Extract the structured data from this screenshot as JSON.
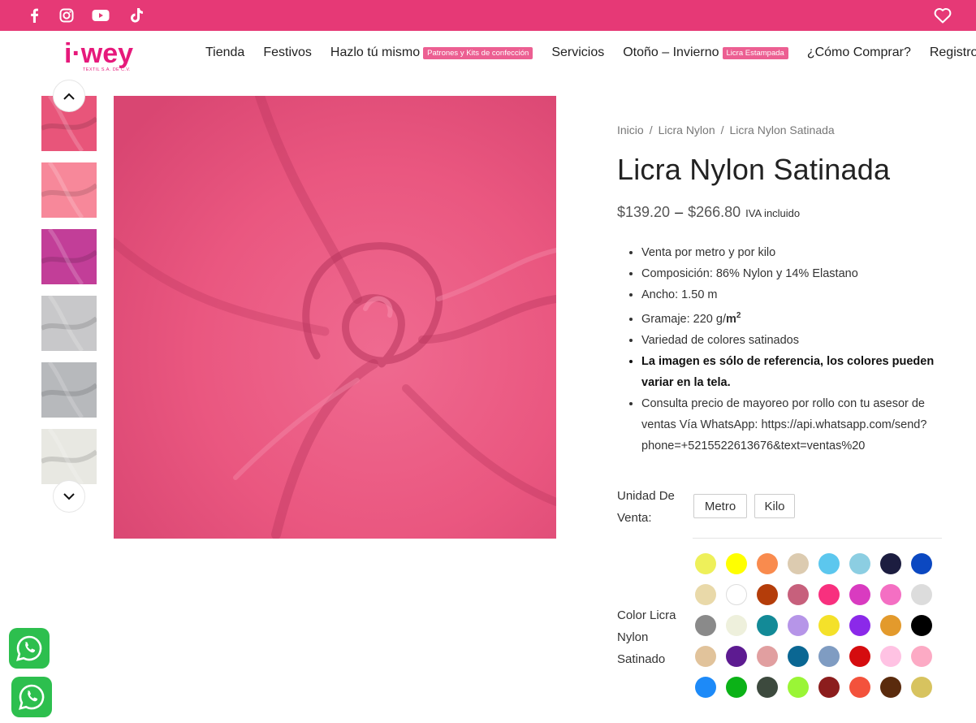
{
  "topbar": {
    "bg_color": "#e63976",
    "icons": [
      "facebook-icon",
      "instagram-icon",
      "youtube-icon",
      "tiktok-icon",
      "heart-icon"
    ]
  },
  "logo": {
    "text": "i·wey",
    "sub": "TEXTIL S.A. DE C.V."
  },
  "menu": [
    {
      "label": "Tienda"
    },
    {
      "label": "Festivos"
    },
    {
      "label": "Hazlo tú mismo",
      "badge": "Patrones y Kits de confección"
    },
    {
      "label": "Servicios"
    },
    {
      "label": "Otoño – Invierno",
      "badge": "Licra Estampada"
    },
    {
      "label": "¿Cómo Comprar?"
    },
    {
      "label": "Registro"
    }
  ],
  "gallery": {
    "thumb_colors": [
      "#e8557a",
      "#f7889a",
      "#c23e98",
      "#c8c8ca",
      "#b7b9bc",
      "#e8e8e2"
    ],
    "main_color": "#ea5780"
  },
  "breadcrumb": [
    "Inicio",
    "Licra Nylon",
    "Licra Nylon Satinada"
  ],
  "product": {
    "title": "Licra Nylon Satinada",
    "price_low": "$139.20",
    "price_dash": "–",
    "price_high": "$266.80",
    "iva": "IVA incluido",
    "features": [
      {
        "text": "Venta por metro y por kilo",
        "bold": false
      },
      {
        "text": "Composición: 86% Nylon y 14% Elastano",
        "bold": false
      },
      {
        "text": "Ancho: 1.50 m",
        "bold": false
      },
      {
        "text": "Gramaje: 220 g/",
        "suffix": "m",
        "sup": "2",
        "bold": false
      },
      {
        "text": "Variedad de colores satinados",
        "bold": false
      },
      {
        "text": "La imagen es sólo de referencia, los colores pueden variar en la tela.",
        "bold": true
      },
      {
        "text": "Consulta precio de mayoreo  por rollo con tu asesor de ventas Vía WhatsApp: https://api.whatsapp.com/send?phone=+5215522613676&text=ventas%20",
        "bold": false
      }
    ]
  },
  "unit": {
    "label": "Unidad De Venta:",
    "options": [
      "Metro",
      "Kilo"
    ]
  },
  "color": {
    "label": "Color Licra Nylon Satinado",
    "swatches": [
      "#eef05a",
      "#ffff00",
      "#f98b4e",
      "#dccbb0",
      "#5cc7ee",
      "#8ccee2",
      "#1c1d40",
      "#0b48c1",
      "#e9d9a9",
      "#ffffff",
      "#b43d0a",
      "#c7607c",
      "#f8307e",
      "#d93bc0",
      "#f46fc3",
      "#dcdcdc",
      "#8a8a8a",
      "#eef0dc",
      "#138a97",
      "#b695e8",
      "#f4e12a",
      "#8b29e9",
      "#e39a2c",
      "#000000",
      "#e1c39b",
      "#5d1b91",
      "#e19fa0",
      "#0a6793",
      "#7f9cc2",
      "#d50c0f",
      "#ffc2e3",
      "#fcaac4",
      "#1d8af8",
      "#0bb217",
      "#3d4a3e",
      "#9af536",
      "#8c1d1d",
      "#f3523c",
      "#5a2b0d",
      "#d7c35f"
    ]
  },
  "whatsapp": {
    "icon": "whatsapp-icon",
    "color": "#2dbf4e"
  }
}
